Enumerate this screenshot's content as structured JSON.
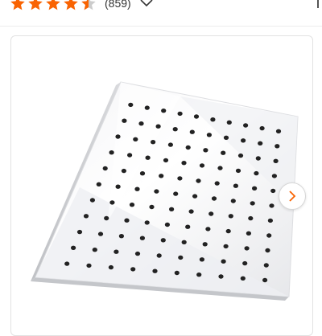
{
  "rating": {
    "stars_filled": 4.5,
    "stars_total": 5,
    "review_count": "(859)",
    "star_color": "#f96302",
    "empty_star_color": "#cccccc"
  },
  "review_dropdown_icon": "chevron-down-icon",
  "product_gallery": {
    "image_subject": "square-rain-shower-head",
    "next_icon": "chevron-right-icon",
    "accent_color": "#f96302"
  }
}
